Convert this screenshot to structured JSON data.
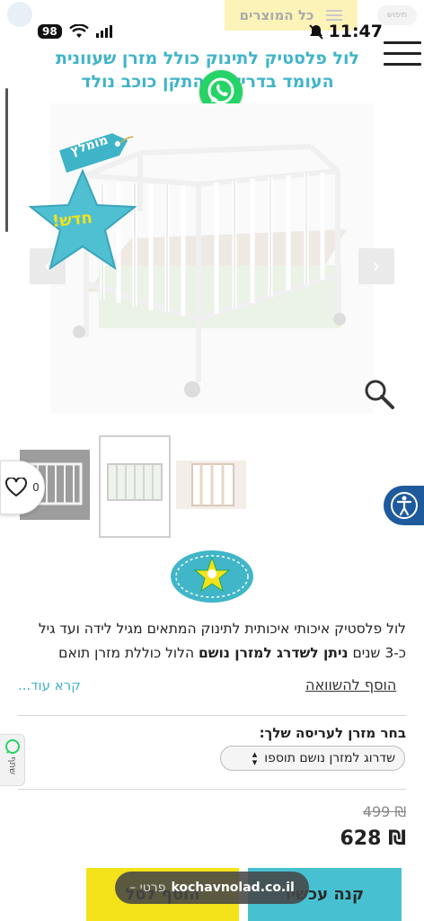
{
  "status": {
    "battery": "98",
    "time": "11:47"
  },
  "header": {
    "all_products": "כל המוצרים",
    "search_hint": "חיפוש"
  },
  "product": {
    "title": "לול פלסטיק לתינוק כולל מזרן שעוונית העומד בדרישות התקן כוכב נולד",
    "tag_label": "מומלץ",
    "new_badge": "חדש!"
  },
  "wishlist": {
    "count": "0"
  },
  "description": {
    "line1": "לול פלסטיק איכותי איכותית לתינוק המתאים מגיל לידה ועד גיל",
    "line2_prefix": "כ-3 שנים ",
    "line2_bold": "ניתן לשדרג למזרן נושם",
    "line2_suffix": " הלול כוללת מזרן תואם",
    "add_compare": "הוסף להשוואה",
    "read_more": "קרא עוד..."
  },
  "options": {
    "label": "בחר מזרן לעריסה שלך:",
    "selected": "שדרוג למזרן נושם תוספו"
  },
  "share": {
    "label": "שתף"
  },
  "price": {
    "old": "₪ 499",
    "current": "₪ 628"
  },
  "actions": {
    "buy_now": "קנה עכשיו",
    "add_to_cart": "הוסף לסל"
  },
  "url_bar": {
    "domain": "kochavnolad.co.il",
    "subtitle": "– פרטי"
  },
  "colors": {
    "accent": "#47c1d1",
    "cart": "#f4e21a",
    "access": "#1e5a9c",
    "whatsapp": "#25d366"
  }
}
